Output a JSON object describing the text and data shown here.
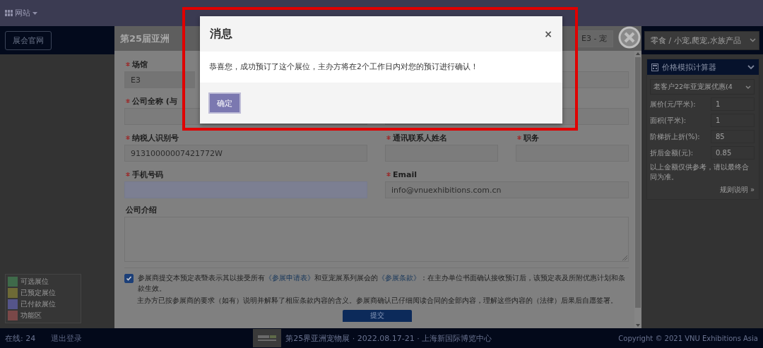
{
  "top_bar": {
    "menu_label": "网站"
  },
  "sidebar": {
    "home_button": "展会官网",
    "legend": [
      {
        "label": "可选展位",
        "color": "#3f6a4a"
      },
      {
        "label": "已预定展位",
        "color": "#6e6a36"
      },
      {
        "label": "已付款展位",
        "color": "#55558a"
      },
      {
        "label": "功能区",
        "color": "#7a4848"
      }
    ]
  },
  "booking_panel": {
    "title": "第25届亚洲",
    "hall_select": "E3 - 宠",
    "rows": [
      [
        {
          "label": "场馆",
          "required": true,
          "value": "E3",
          "autofill": false
        },
        {
          "autofill": false
        }
      ],
      [
        {
          "label": "公司全称 (与",
          "required": true,
          "autofill": false
        },
        {
          "autofill": false
        }
      ],
      [
        {
          "label": "纳税人识别号",
          "required": true,
          "value": "91310000007421772W",
          "autofill": false
        },
        {
          "label": "通讯联系人姓名",
          "required": true,
          "autofill": false
        },
        {
          "label": "职务",
          "required": true,
          "autofill": false
        }
      ],
      [
        {
          "label": "手机号码",
          "required": true,
          "autofill": true
        },
        {
          "label": "Email",
          "required": true,
          "value": "info@vnuexhibitions.com.cn",
          "autofill": false
        }
      ]
    ],
    "intro_label": "公司介绍",
    "agreement": {
      "checked": true,
      "parts": [
        {
          "text": "参展商提交本预定表暨表示其以接受所有",
          "kind": "text"
        },
        {
          "text": "《参展申请表》",
          "kind": "link"
        },
        {
          "text": "和亚宠展系列展会的",
          "kind": "text"
        },
        {
          "text": "《参展条款》",
          "kind": "link"
        },
        {
          "text": "：在主办单位书面确认接收预订后，该预定表及所附优惠计划和条款生效。",
          "kind": "text"
        }
      ]
    },
    "note": "主办方已按参展商的要求（如有）说明并解释了相应条款内容的含义。参展商确认已仔细阅读合同的全部内容，理解这些内容的（法律）后果后自愿签署。",
    "submit": "提交"
  },
  "category_select": "零食 / 小宠,爬宠,水族产品",
  "calculator": {
    "title": "价格模拟计算器",
    "expanded": true,
    "plan": "老客户22年亚宠展优惠(4",
    "rows": [
      {
        "label": "展价(元/平米):",
        "value": "1"
      },
      {
        "label": "面积(平米):",
        "value": "1"
      },
      {
        "label": "阶梯折上折(%):",
        "value": "85"
      },
      {
        "label": "折后金额(元):",
        "value": "0.85"
      }
    ],
    "note": "以上金额仅供参考，请以最终合同为准。",
    "rules_link": "规则说明 »"
  },
  "dialog": {
    "title": "消息",
    "close": "×",
    "message": "恭喜您，成功预订了这个展位，主办方将在2个工作日内对您的预订进行确认！",
    "ok_button": "确定"
  },
  "footer": {
    "online": "在线: 24",
    "logout": "退出登录",
    "event": "第25界亚洲宠物展 · 2022.08.17-21 · 上海新国际博览中心",
    "copyright": "Copyright © 2021 VNU Exhibitions Asia"
  }
}
